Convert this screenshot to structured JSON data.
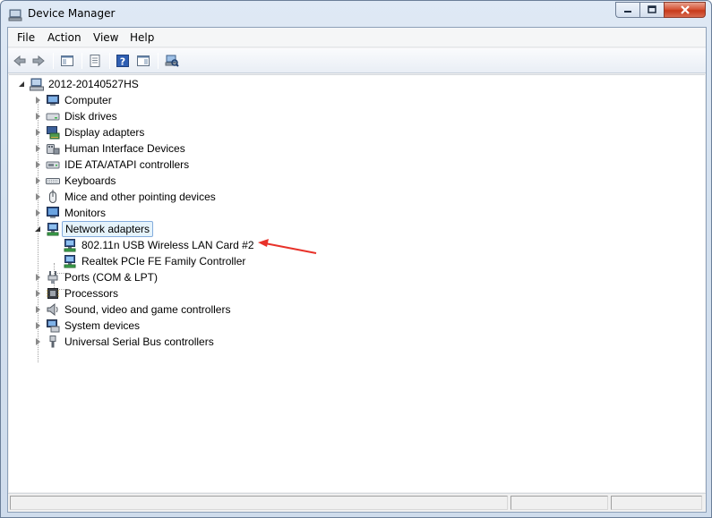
{
  "window": {
    "title": "Device Manager"
  },
  "menu": {
    "items": [
      "File",
      "Action",
      "View",
      "Help"
    ]
  },
  "toolbar": {
    "buttons": [
      "back-icon",
      "forward-icon",
      "show-hide-console-tree-icon",
      "properties-icon",
      "help-icon",
      "action-pane-icon",
      "scan-hardware-icon"
    ]
  },
  "tree": {
    "root": "2012-20140527HS",
    "categories": [
      "Computer",
      "Disk drives",
      "Display adapters",
      "Human Interface Devices",
      "IDE ATA/ATAPI controllers",
      "Keyboards",
      "Mice and other pointing devices",
      "Monitors",
      "Network adapters",
      "Ports (COM & LPT)",
      "Processors",
      "Sound, video and game controllers",
      "System devices",
      "Universal Serial Bus controllers"
    ],
    "network_children": [
      "802.11n USB Wireless LAN Card #2",
      "Realtek PCIe FE Family Controller"
    ]
  },
  "colors": {
    "annotation_arrow": "#e8322a",
    "selection_border": "#84acdd",
    "selection_fill": "#e5f3fb"
  }
}
